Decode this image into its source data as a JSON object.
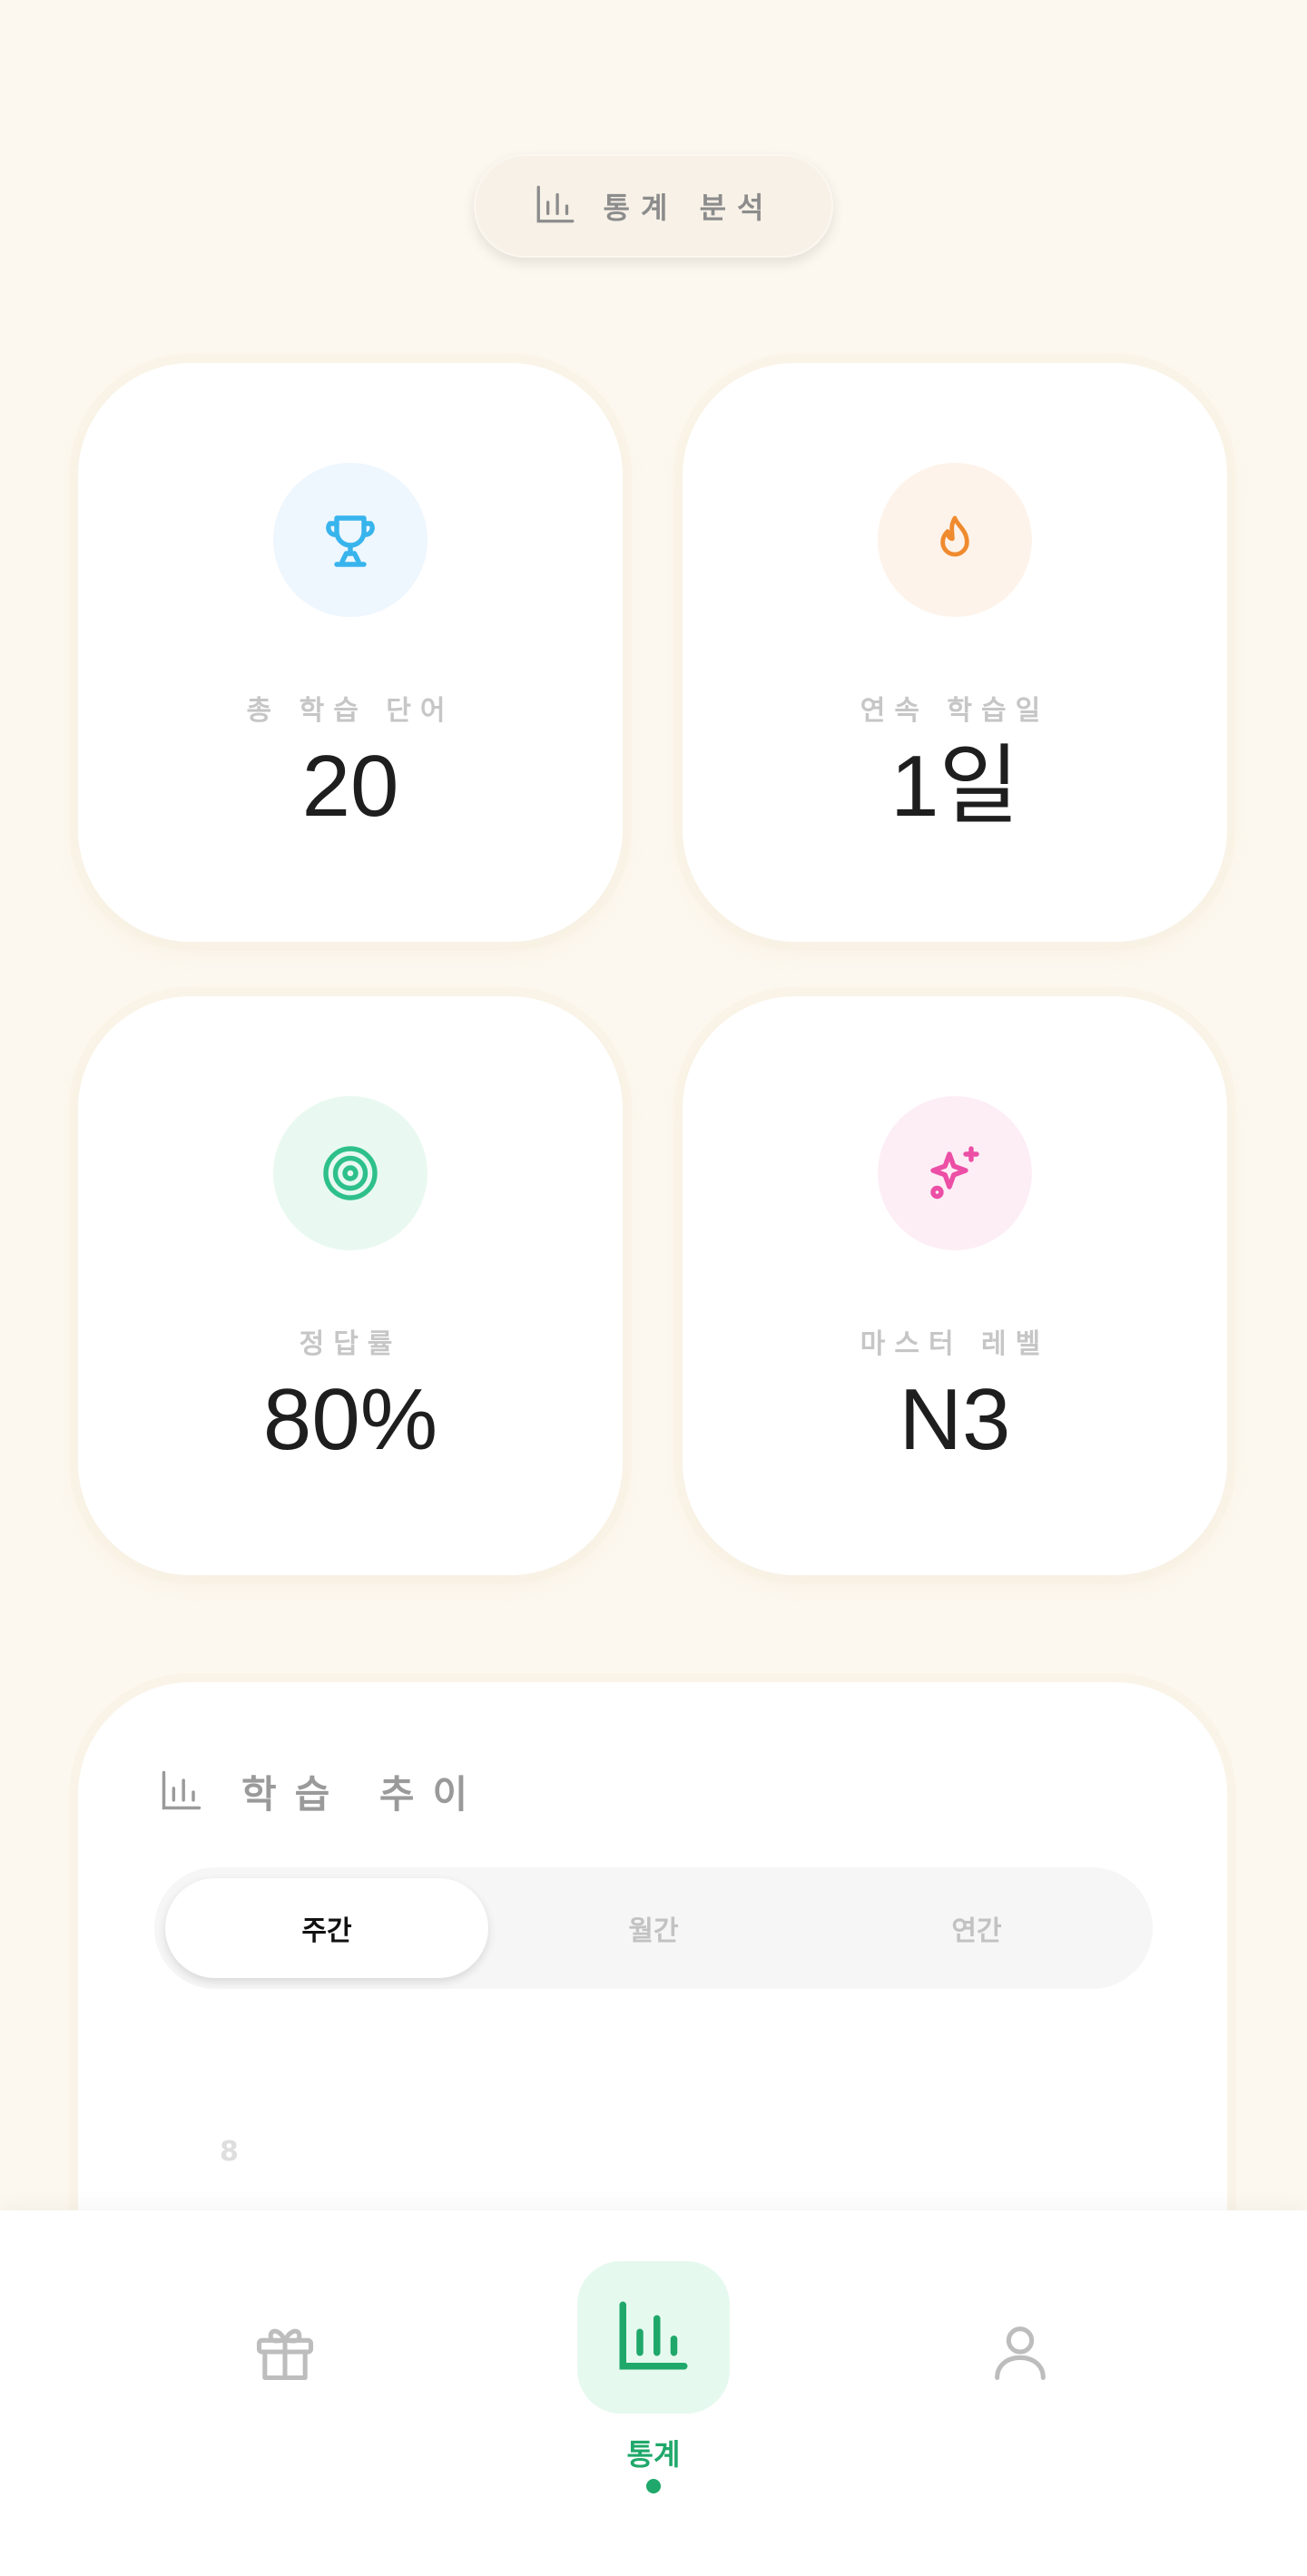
{
  "header": {
    "title": "통계 분석",
    "icon": "bar-chart-icon"
  },
  "stats": [
    {
      "label": "총 학습 단어",
      "value": "20",
      "icon": "trophy-icon",
      "icon_color": "#38b4ec",
      "bg_color": "#eef6fe"
    },
    {
      "label": "연속 학습일",
      "value": "1일",
      "icon": "flame-icon",
      "icon_color": "#f08a2e",
      "bg_color": "#fdf3ea"
    },
    {
      "label": "정답률",
      "value": "80%",
      "icon": "target-icon",
      "icon_color": "#2ec08a",
      "bg_color": "#e9f9f1"
    },
    {
      "label": "마스터 레벨",
      "value": "N3",
      "icon": "sparkles-icon",
      "icon_color": "#ec4fa5",
      "bg_color": "#fdeef6"
    }
  ],
  "trend": {
    "title": "학습 추이",
    "icon": "bar-chart-icon",
    "tabs": [
      {
        "label": "주간",
        "active": true
      },
      {
        "label": "월간",
        "active": false
      },
      {
        "label": "연간",
        "active": false
      }
    ],
    "axis_tick": "8"
  },
  "nav": {
    "items": [
      {
        "name": "gift",
        "icon": "gift-icon"
      },
      {
        "name": "stats",
        "icon": "bar-chart-icon",
        "label": "통계",
        "active": true
      },
      {
        "name": "profile",
        "icon": "user-icon"
      }
    ],
    "accent_color": "#1fa86a"
  }
}
